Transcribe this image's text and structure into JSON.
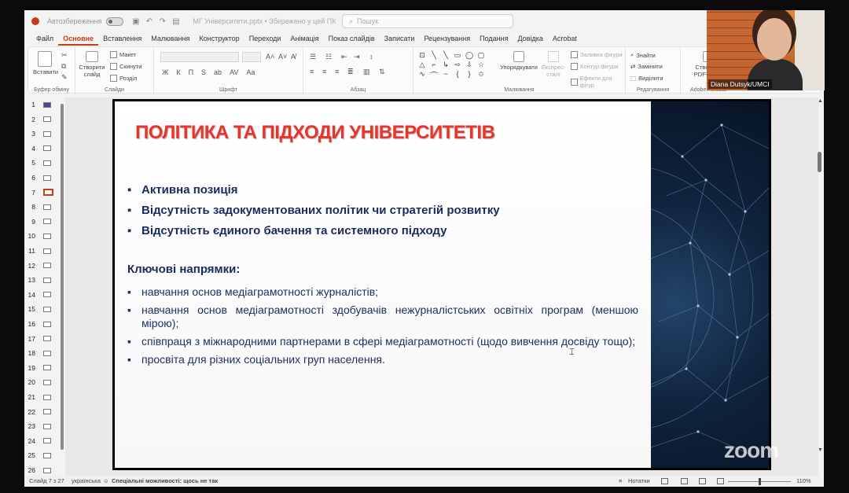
{
  "window": {
    "autosave_label": "Автозбереження",
    "doc_title": "МГ Університети.pptx • Збережено у цей ПК",
    "search_placeholder": "Пошук"
  },
  "tabs": [
    "Файл",
    "Основне",
    "Вставлення",
    "Малювання",
    "Конструктор",
    "Переходи",
    "Анімація",
    "Показ слайдів",
    "Записати",
    "Рецензування",
    "Подання",
    "Довідка",
    "Acrobat"
  ],
  "ribbon": {
    "clipboard": {
      "paste": "Вставити",
      "label": "Буфер обміну"
    },
    "slides": {
      "new_slide": "Створити слайд",
      "layout": "Макет",
      "reset": "Скинути",
      "sections": "Розділ",
      "label": "Слайди"
    },
    "font": {
      "label": "Шрифт",
      "glyphs": [
        "Ж",
        "К",
        "П",
        "S",
        "ab",
        "AV",
        "Aa"
      ]
    },
    "paragraph": {
      "label": "Абзац"
    },
    "drawing": {
      "arrange": "Упорядкувати",
      "quick_styles": "Експрес-стилі",
      "fill": "Заливка фігури",
      "outline": "Контур фігури",
      "effects": "Ефекти для фігур",
      "label": "Малювання"
    },
    "editing": {
      "find": "Знайти",
      "replace": "Замінити",
      "select": "Виділити",
      "label": "Редагування"
    },
    "acrobat": {
      "create_pdf": "Створити PDF-файл",
      "label": "Adobe Acrobat"
    }
  },
  "thumbnails": [
    "1",
    "2",
    "3",
    "4",
    "5",
    "6",
    "7",
    "8",
    "9",
    "10",
    "11",
    "12",
    "13",
    "14",
    "15",
    "16",
    "17",
    "18",
    "19",
    "20",
    "21",
    "22",
    "23",
    "24",
    "25",
    "26"
  ],
  "active_slide": 7,
  "slide": {
    "title": "ПОЛІТИКА ТА ПІДХОДИ УНІВЕРСИТЕТІВ",
    "main_bullets": [
      "Активна позиція",
      "Відсутність задокументованих політик чи стратегій розвитку",
      "Відсутність єдиного бачення та системного підходу"
    ],
    "key_heading": "Ключові напрямки:",
    "key_bullets": [
      "навчання основ медіаграмотності журналістів;",
      "навчання основ медіаграмотності здобувачів нежурналістських освітніх програм (меншою мірою);",
      "співпраця з міжнародними партнерами в сфері медіаграмотності (щодо вивчення досвіду тощо);",
      "просвіта для різних соціальних груп населення."
    ]
  },
  "status": {
    "slide_counter": "Слайд 7 з 27",
    "language": "українська",
    "accessibility": "Спеціальні можливості: щось не так",
    "notes": "Нотатки",
    "zoom": "110%"
  },
  "video": {
    "participant": "Diana Dutsyk/UMCI"
  },
  "watermark": "zoom",
  "colors": {
    "accent": "#c43e1c",
    "title_red": "#e8352b",
    "bullet_navy": "#1b2a5c"
  }
}
